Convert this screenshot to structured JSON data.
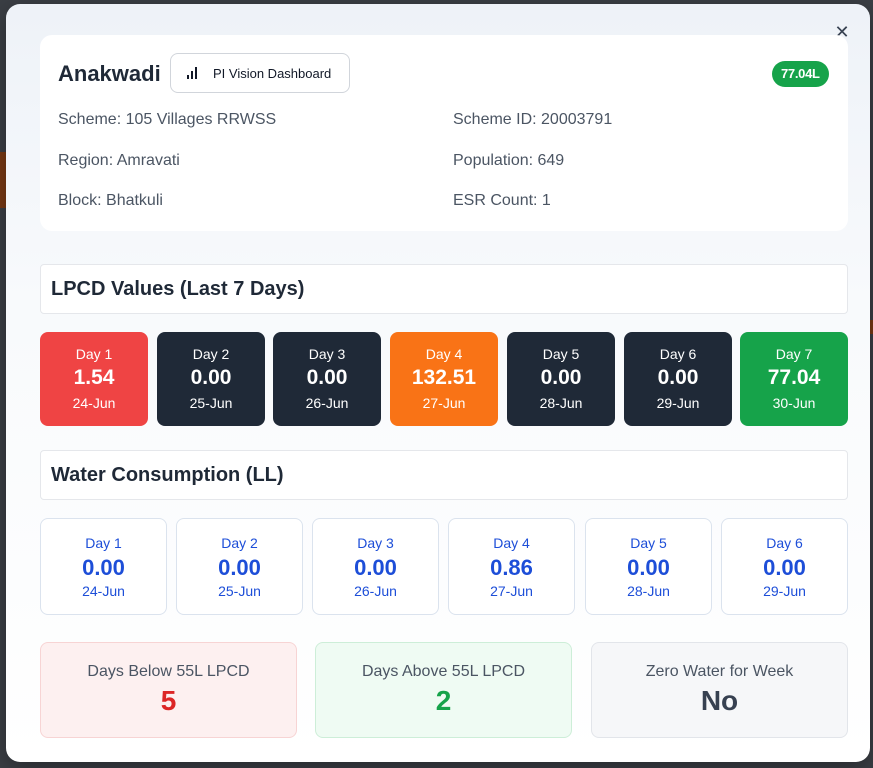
{
  "header": {
    "village": "Anakwadi",
    "pi_button_label": "PI Vision Dashboard",
    "badge": "77.04L",
    "scheme": "Scheme: 105 Villages RRWSS",
    "scheme_id": "Scheme ID: 20003791",
    "region": "Region: Amravati",
    "population": "Population: 649",
    "block": "Block: Bhatkuli",
    "esr_count": "ESR Count: 1"
  },
  "close_label": "✕",
  "lpcd": {
    "title": "LPCD Values (Last 7 Days)",
    "days": [
      {
        "day": "Day 1",
        "value": "1.54",
        "date": "24-Jun",
        "color": "#ef4444"
      },
      {
        "day": "Day 2",
        "value": "0.00",
        "date": "25-Jun",
        "color": "#1f2937"
      },
      {
        "day": "Day 3",
        "value": "0.00",
        "date": "26-Jun",
        "color": "#1f2937"
      },
      {
        "day": "Day 4",
        "value": "132.51",
        "date": "27-Jun",
        "color": "#f97316"
      },
      {
        "day": "Day 5",
        "value": "0.00",
        "date": "28-Jun",
        "color": "#1f2937"
      },
      {
        "day": "Day 6",
        "value": "0.00",
        "date": "29-Jun",
        "color": "#1f2937"
      },
      {
        "day": "Day 7",
        "value": "77.04",
        "date": "30-Jun",
        "color": "#16a34a"
      }
    ]
  },
  "water": {
    "title": "Water Consumption (LL)",
    "days": [
      {
        "day": "Day 1",
        "value": "0.00",
        "date": "24-Jun"
      },
      {
        "day": "Day 2",
        "value": "0.00",
        "date": "25-Jun"
      },
      {
        "day": "Day 3",
        "value": "0.00",
        "date": "26-Jun"
      },
      {
        "day": "Day 4",
        "value": "0.86",
        "date": "27-Jun"
      },
      {
        "day": "Day 5",
        "value": "0.00",
        "date": "28-Jun"
      },
      {
        "day": "Day 6",
        "value": "0.00",
        "date": "29-Jun"
      }
    ]
  },
  "summary": {
    "below": {
      "label": "Days Below 55L LPCD",
      "value": "5",
      "color": "#dc2626",
      "bg": "#fdf0f0",
      "border": "#f7d4d4"
    },
    "above": {
      "label": "Days Above 55L LPCD",
      "value": "2",
      "color": "#16a34a",
      "bg": "#effbf3",
      "border": "#cdeed8"
    },
    "zero": {
      "label": "Zero Water for Week",
      "value": "No",
      "color": "#374151",
      "bg": "#f6f7f9",
      "border": "#e2e5ea"
    }
  }
}
